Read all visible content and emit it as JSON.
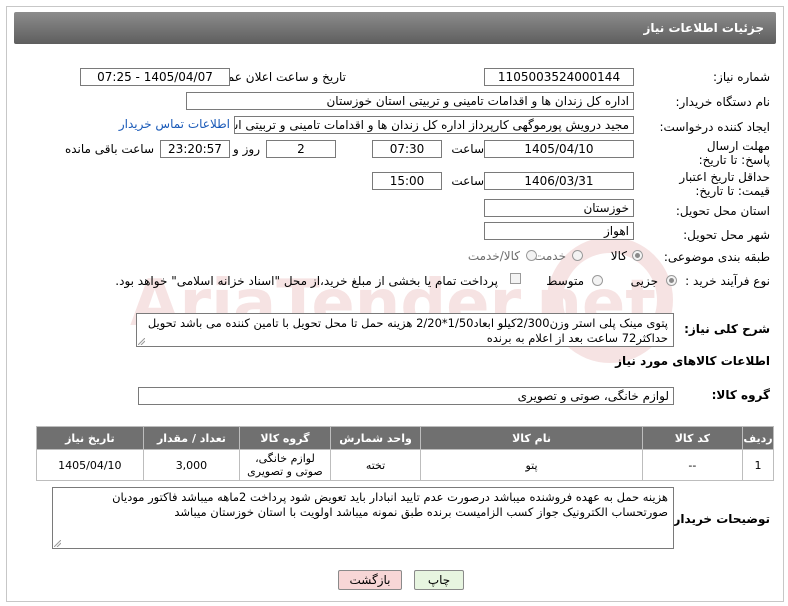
{
  "header": {
    "title": "جزئیات اطلاعات نیاز"
  },
  "fields": {
    "need_number": {
      "label": "شماره نیاز:",
      "value": "1105003524000144"
    },
    "announce_datetime": {
      "label": "تاریخ و ساعت اعلان عمومی:",
      "value": "1405/04/07 - 07:25"
    },
    "buyer_org": {
      "label": "نام دستگاه خریدار:",
      "value": "اداره کل زندان ها و اقدامات تامینی و تربیتی استان خوزستان"
    },
    "requester": {
      "label": "ایجاد کننده درخواست:",
      "value": "مجید درویش پورموگهی کارپرداز اداره کل زندان ها و اقدامات تامینی و تربیتی استان",
      "contact_link": "اطلاعات تماس خریدار"
    },
    "deadline_reply": {
      "label": "مهلت ارسال پاسخ: تا تاریخ:",
      "date": "1405/04/10",
      "time_label": "ساعت",
      "time": "07:30",
      "days": "2",
      "days_label": "روز و",
      "remaining": "23:20:57",
      "remaining_label": "ساعت باقی مانده"
    },
    "price_validity": {
      "label": "حداقل تاریخ اعتبار قیمت: تا تاریخ:",
      "date": "1406/03/31",
      "time_label": "ساعت",
      "time": "15:00"
    },
    "delivery_province": {
      "label": "استان محل تحویل:",
      "value": "خوزستان"
    },
    "delivery_city": {
      "label": "شهر محل تحویل:",
      "value": "اهواز"
    },
    "subject_class": {
      "label": "طبقه بندی موضوعی:",
      "options": [
        "کالا",
        "خدمت",
        "کالا/خدمت"
      ],
      "selected": "کالا"
    },
    "process_type": {
      "label": "نوع فرآیند خرید :",
      "options": [
        "جزیی",
        "متوسط"
      ],
      "selected": "جزیی",
      "payment_text": "پرداخت تمام یا بخشی از مبلغ خرید،از محل \"اسناد خزانه اسلامی\" خواهد بود."
    }
  },
  "description": {
    "label": "شرح کلی نیاز:",
    "text": "پتوی مینک پلی استر وزن2/300کیلو ابعاد1/50*2/20  هزینه حمل تا محل تحویل با تامین کننده می باشد تحویل حداکثر72 ساعت بعد از اعلام به برنده"
  },
  "goods_info": {
    "title": "اطلاعات کالاهای مورد نیاز",
    "group_label": "گروه کالا:",
    "group_value": "لوازم خانگی، صوتی و تصویری"
  },
  "table": {
    "headers": [
      "ردیف",
      "کد کالا",
      "نام کالا",
      "واحد شمارش",
      "گروه کالا",
      "تعداد / مقدار",
      "تاریخ نیاز"
    ],
    "rows": [
      [
        "1",
        "--",
        "پتو",
        "تخته",
        "لوازم خانگی، صوتی و تصویری",
        "3,000",
        "1405/04/10"
      ]
    ]
  },
  "buyer_notes": {
    "label": "توضیحات خریدار:",
    "text": "هزینه حمل به عهده فروشنده میباشد درصورت عدم تایید انبادار باید تعویض شود پرداخت 2ماهه میباشد فاکتور مودیان صورتحساب الکترونیک جواز کسب الزامیست برنده طبق نمونه میباشد اولویت با استان خوزستان میباشد"
  },
  "buttons": {
    "print": "چاپ",
    "back": "بازگشت"
  },
  "colors": {
    "header": "#6e6e6e",
    "link": "#1a5ab8",
    "back_button": "#f7d6d6",
    "print_button": "#e7f5e0"
  },
  "watermark_text": "AriaTender.net"
}
